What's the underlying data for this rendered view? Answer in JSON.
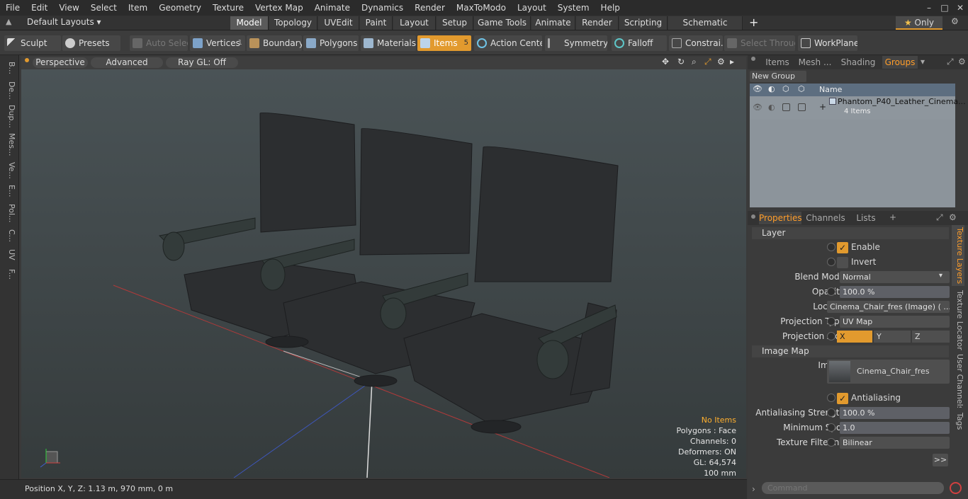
{
  "menu": [
    "File",
    "Edit",
    "View",
    "Select",
    "Item",
    "Geometry",
    "Texture",
    "Vertex Map",
    "Animate",
    "Dynamics",
    "Render",
    "MaxToModo",
    "Layout",
    "System",
    "Help"
  ],
  "layouts": {
    "current": "Default Layouts",
    "tabs": [
      "Model",
      "Topology",
      "UVEdit",
      "Paint",
      "Layout",
      "Setup",
      "Game Tools",
      "Animate",
      "Render",
      "Scripting",
      "Schematic Fusion"
    ],
    "active_tab": "Model",
    "add": "+",
    "only_label": "Only"
  },
  "toolbar": {
    "sculpt": "Sculpt",
    "presets": "Presets",
    "auto_select": "Auto Select",
    "vertices": "Vertices",
    "vertices_count": "1",
    "boundary": "Boundary",
    "polygons": "Polygons",
    "materials": "Materials",
    "items": "Items",
    "items_count": "5",
    "action_center": "Action Center",
    "symmetry": "Symmetry",
    "falloff": "Falloff",
    "constraints": "Constrai...",
    "select_through": "Select Through",
    "workplane": "WorkPlane"
  },
  "left_tabs": [
    "B...",
    "De...",
    "Dup...",
    "Mes...",
    "Ve...",
    "E...",
    "Pol...",
    "C...",
    "UV",
    "F..."
  ],
  "viewport": {
    "view": "Perspective",
    "shading": "Advanced",
    "raygl": "Ray GL: Off",
    "info": {
      "no_items": "No Items",
      "polygons": "Polygons : Face",
      "channels": "Channels: 0",
      "deformers": "Deformers: ON",
      "gl": "GL: 64,574",
      "scale": "100 mm"
    },
    "accent_color": "#ffb02e"
  },
  "status": {
    "position": "Position X, Y, Z:  1.13 m, 970 mm, 0 m"
  },
  "top_panel": {
    "tabs": [
      "Items",
      "Mesh ...",
      "Shading",
      "Groups"
    ],
    "active_tab": "Groups",
    "new_group": "New Group",
    "col_name": "Name",
    "group_name": "Phantom_P40_Leather_Cinema...",
    "group_count": "4 Items"
  },
  "props_panel": {
    "tabs": [
      "Properties",
      "Channels",
      "Lists"
    ],
    "active_tab": "Properties",
    "layer_header": "Layer",
    "enable": "Enable",
    "invert": "Invert",
    "blend_mode_label": "Blend Mode",
    "blend_mode": "Normal",
    "opacity_label": "Opacity",
    "opacity": "100.0 %",
    "locator_label": "Locator",
    "locator": "Cinema_Chair_fres (Image) ( ...",
    "proj_type_label": "Projection Type",
    "proj_type": "UV Map",
    "proj_axis_label": "Projection Axis",
    "axes": [
      "X",
      "Y",
      "Z"
    ],
    "image_map_header": "Image Map",
    "image_label": "Image",
    "image": "Cinema_Chair_fres",
    "antialiasing": "Antialiasing",
    "aa_strength_label": "Antialiasing Strength",
    "aa_strength": "100.0 %",
    "min_spot_label": "Minimum Spot",
    "min_spot": "1.0",
    "tex_filter_label": "Texture Filtering",
    "tex_filter": "Bilinear",
    "more": ">>",
    "side_tabs": [
      "Texture Layers",
      "Texture Locator",
      "User Channels",
      "Tags"
    ],
    "active_side_tab": "Texture Layers"
  },
  "command": {
    "placeholder": "Command"
  }
}
